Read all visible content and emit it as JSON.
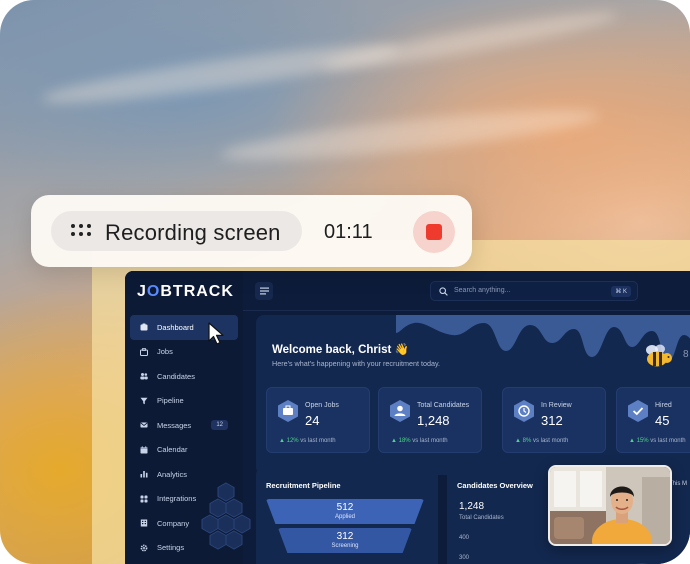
{
  "recording": {
    "label": "Recording screen",
    "time": "01:11"
  },
  "app": {
    "logo": "JOBTRACK",
    "search_placeholder": "Search anything...",
    "search_shortcut": "⌘ K",
    "nav": [
      {
        "label": "Dashboard",
        "icon": "dashboard-icon",
        "active": true
      },
      {
        "label": "Jobs",
        "icon": "briefcase-icon"
      },
      {
        "label": "Candidates",
        "icon": "users-icon"
      },
      {
        "label": "Pipeline",
        "icon": "pipeline-icon"
      },
      {
        "label": "Messages",
        "icon": "mail-icon",
        "badge": "12"
      },
      {
        "label": "Calendar",
        "icon": "calendar-icon"
      },
      {
        "label": "Analytics",
        "icon": "analytics-icon"
      },
      {
        "label": "Integrations",
        "icon": "grid-icon"
      },
      {
        "label": "Company",
        "icon": "building-icon"
      },
      {
        "label": "Settings",
        "icon": "gear-icon"
      }
    ],
    "welcome": {
      "title": "Welcome back, Christ 👋",
      "subtitle": "Here's what's happening with your recruitment today."
    },
    "stats": [
      {
        "label": "Open Jobs",
        "value": "24",
        "delta": "▲ 12%",
        "delta_text": "vs last month",
        "icon": "briefcase-icon"
      },
      {
        "label": "Total Candidates",
        "value": "1,248",
        "delta": "▲ 18%",
        "delta_text": "vs last month",
        "icon": "user-icon"
      },
      {
        "label": "In Review",
        "value": "312",
        "delta": "▲ 8%",
        "delta_text": "vs last month",
        "icon": "clock-icon"
      },
      {
        "label": "Hired",
        "value": "45",
        "delta": "▲ 15%",
        "delta_text": "vs last month",
        "icon": "check-icon"
      }
    ],
    "pipeline": {
      "title": "Recruitment Pipeline",
      "steps": [
        {
          "value": "512",
          "label": "Applied"
        },
        {
          "value": "312",
          "label": "Screening"
        }
      ]
    },
    "overview": {
      "title": "Candidates Overview",
      "total_value": "1,248",
      "total_label": "Total Candidates",
      "axis": [
        "400",
        "300"
      ]
    },
    "partial_labels": {
      "right_edge_a": "8",
      "right_edge_b": "This M"
    }
  },
  "colors": {
    "accent": "#5d8cff",
    "stop": "#ee3b2d",
    "positive": "#4fd38a"
  }
}
